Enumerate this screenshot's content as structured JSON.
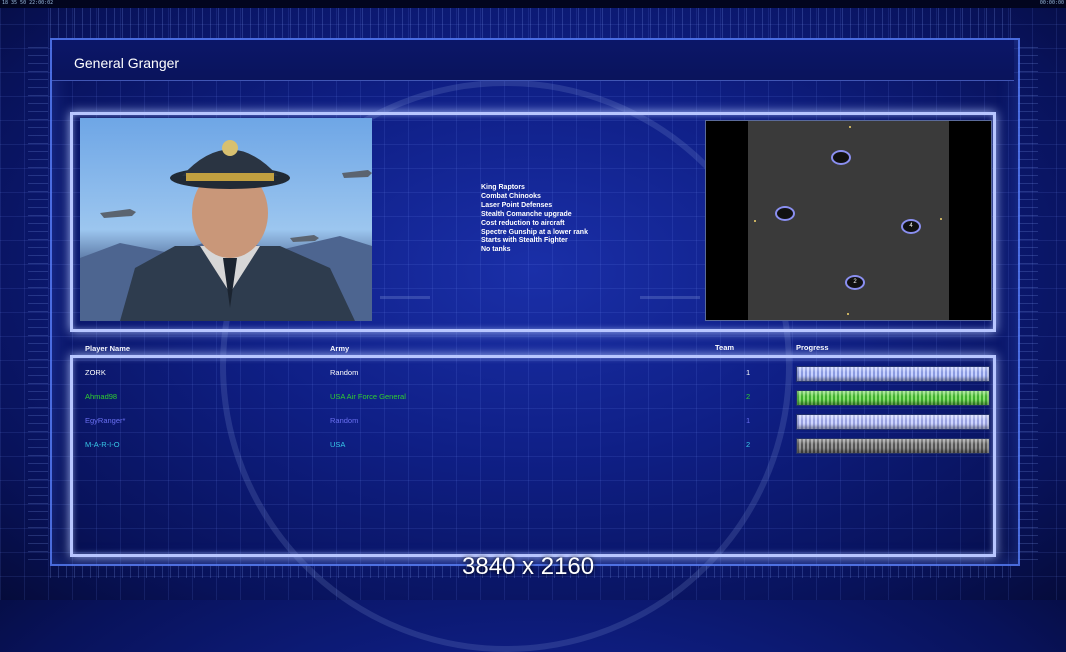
{
  "status_bar": {
    "left": "18 35 50 22:00:02",
    "right": "00:00:00"
  },
  "general": {
    "name": "General Granger"
  },
  "features": [
    "King Raptors",
    "Combat Chinooks",
    "Laser Point Defenses",
    "Stealth Comanche upgrade",
    "Cost reduction to aircraft",
    "Spectre Gunship at a lower rank",
    "Starts with Stealth Fighter",
    "No tanks"
  ],
  "minimap": {
    "slots": [
      {
        "label": ""
      },
      {
        "label": ""
      },
      {
        "label": "4"
      },
      {
        "label": "2"
      }
    ]
  },
  "table": {
    "headers": {
      "player": "Player Name",
      "army": "Army",
      "team": "Team",
      "progress": "Progress"
    },
    "rows": [
      {
        "player": "ZORK",
        "army": "Random",
        "team": "1",
        "color": "#ffffff",
        "progress": 1.0,
        "bar_style": "blue"
      },
      {
        "player": "Ahmad98",
        "army": "USA Air Force General",
        "team": "2",
        "color": "#2fd02f",
        "progress": 1.0,
        "bar_style": "green"
      },
      {
        "player": "EgyRanger*",
        "army": "Random",
        "team": "1",
        "color": "#6a6ff0",
        "progress": 1.0,
        "bar_style": "lavender"
      },
      {
        "player": "M-A-R-I-O",
        "army": "USA",
        "team": "2",
        "color": "#38c8e8",
        "progress": 1.0,
        "bar_style": "grey"
      }
    ]
  },
  "resolution_label": "3840 x 2160",
  "colors": {
    "panel_border": "#b8c6ff",
    "background": "#0f1f86"
  }
}
